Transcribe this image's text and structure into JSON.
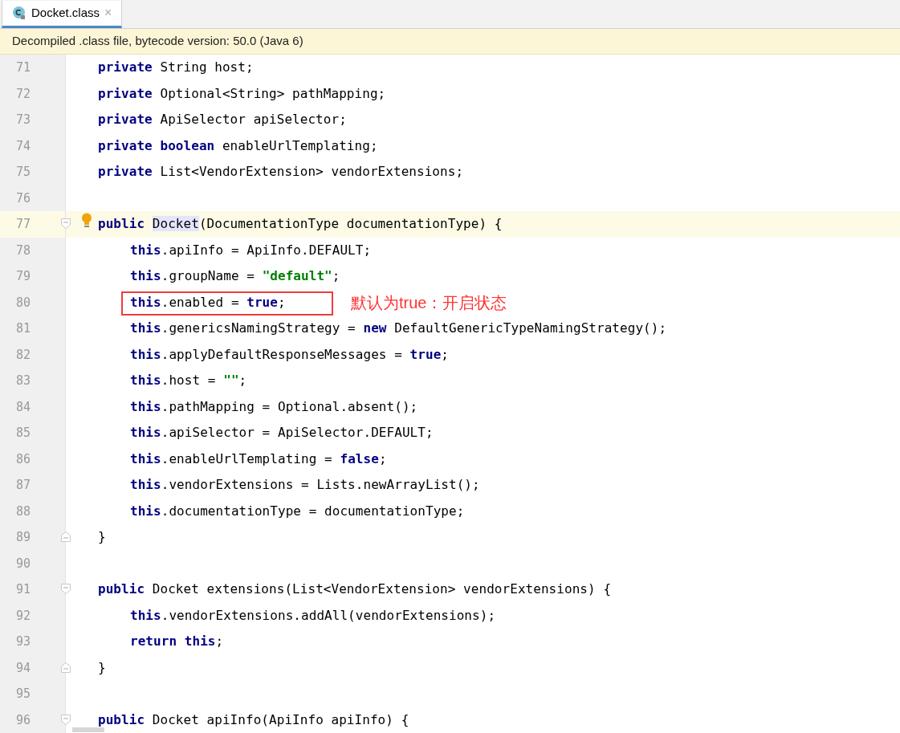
{
  "tab": {
    "title": "Docket.class",
    "selected": true,
    "close": "×"
  },
  "banner": "Decompiled .class file, bytecode version: 50.0 (Java 6)",
  "lines": [
    {
      "number": "71",
      "kind": "member",
      "segments": [
        {
          "kind": "kw",
          "t": "private"
        },
        {
          "kind": "plain",
          "t": " String host;"
        }
      ]
    },
    {
      "number": "72",
      "kind": "member",
      "segments": [
        {
          "kind": "kw",
          "t": "private"
        },
        {
          "kind": "plain",
          "t": " Optional<String> pathMapping;"
        }
      ]
    },
    {
      "number": "73",
      "kind": "member",
      "segments": [
        {
          "kind": "kw",
          "t": "private"
        },
        {
          "kind": "plain",
          "t": " ApiSelector apiSelector;"
        }
      ]
    },
    {
      "number": "74",
      "kind": "member",
      "segments": [
        {
          "kind": "kw",
          "t": "private boolean"
        },
        {
          "kind": "plain",
          "t": " enableUrlTemplating;"
        }
      ]
    },
    {
      "number": "75",
      "kind": "member",
      "segments": [
        {
          "kind": "kw",
          "t": "private"
        },
        {
          "kind": "plain",
          "t": " List<VendorExtension> vendorExtensions;"
        }
      ]
    },
    {
      "number": "76"
    },
    {
      "number": "77",
      "kind": "member",
      "current": true,
      "bulb": true,
      "fold": {
        "kind": "start"
      },
      "segments": [
        {
          "kind": "kw",
          "t": "public "
        },
        {
          "kind": "ref",
          "t": "Docket"
        },
        {
          "kind": "plain",
          "t": "(DocumentationType documentationType) {"
        }
      ]
    },
    {
      "number": "78",
      "kind": "statement",
      "segments": [
        {
          "kind": "kw",
          "t": "this"
        },
        {
          "kind": "plain",
          "t": ".apiInfo = ApiInfo.DEFAULT;"
        }
      ]
    },
    {
      "number": "79",
      "kind": "statement",
      "segments": [
        {
          "kind": "kw",
          "t": "this"
        },
        {
          "kind": "plain",
          "t": ".groupName = "
        },
        {
          "kind": "str",
          "t": "\"default\""
        },
        {
          "kind": "plain",
          "t": ";"
        }
      ]
    },
    {
      "number": "80",
      "kind": "statement",
      "note": "默认为true：开启状态",
      "segments": [
        {
          "kind": "kw",
          "t": "this"
        },
        {
          "kind": "plain",
          "t": ".enabled = "
        },
        {
          "kind": "kw",
          "t": "true"
        },
        {
          "kind": "plain",
          "t": ";"
        }
      ]
    },
    {
      "number": "81",
      "kind": "statement",
      "segments": [
        {
          "kind": "kw",
          "t": "this"
        },
        {
          "kind": "plain",
          "t": ".genericsNamingStrategy = "
        },
        {
          "kind": "kw",
          "t": "new"
        },
        {
          "kind": "plain",
          "t": " DefaultGenericTypeNamingStrategy();"
        }
      ]
    },
    {
      "number": "82",
      "kind": "statement",
      "segments": [
        {
          "kind": "kw",
          "t": "this"
        },
        {
          "kind": "plain",
          "t": ".applyDefaultResponseMessages = "
        },
        {
          "kind": "kw",
          "t": "true"
        },
        {
          "kind": "plain",
          "t": ";"
        }
      ]
    },
    {
      "number": "83",
      "kind": "statement",
      "segments": [
        {
          "kind": "kw",
          "t": "this"
        },
        {
          "kind": "plain",
          "t": ".host = "
        },
        {
          "kind": "str",
          "t": "\"\""
        },
        {
          "kind": "plain",
          "t": ";"
        }
      ]
    },
    {
      "number": "84",
      "kind": "statement",
      "segments": [
        {
          "kind": "kw",
          "t": "this"
        },
        {
          "kind": "plain",
          "t": ".pathMapping = Optional.absent();"
        }
      ]
    },
    {
      "number": "85",
      "kind": "statement",
      "segments": [
        {
          "kind": "kw",
          "t": "this"
        },
        {
          "kind": "plain",
          "t": ".apiSelector = ApiSelector.DEFAULT;"
        }
      ]
    },
    {
      "number": "86",
      "kind": "statement",
      "segments": [
        {
          "kind": "kw",
          "t": "this"
        },
        {
          "kind": "plain",
          "t": ".enableUrlTemplating = "
        },
        {
          "kind": "kw",
          "t": "false"
        },
        {
          "kind": "plain",
          "t": ";"
        }
      ]
    },
    {
      "number": "87",
      "kind": "statement",
      "segments": [
        {
          "kind": "kw",
          "t": "this"
        },
        {
          "kind": "plain",
          "t": ".vendorExtensions = Lists.newArrayList();"
        }
      ]
    },
    {
      "number": "88",
      "kind": "statement",
      "segments": [
        {
          "kind": "kw",
          "t": "this"
        },
        {
          "kind": "plain",
          "t": ".documentationType = documentationType;"
        }
      ]
    },
    {
      "number": "89",
      "kind": "member",
      "fold": {
        "kind": "end"
      },
      "segments": [
        {
          "kind": "plain",
          "t": "}"
        }
      ]
    },
    {
      "number": "90"
    },
    {
      "number": "91",
      "kind": "member",
      "fold": {
        "kind": "start"
      },
      "segments": [
        {
          "kind": "kw",
          "t": "public"
        },
        {
          "kind": "plain",
          "t": " Docket extensions(List<VendorExtension> vendorExtensions) {"
        }
      ]
    },
    {
      "number": "92",
      "kind": "statement",
      "segments": [
        {
          "kind": "kw",
          "t": "this"
        },
        {
          "kind": "plain",
          "t": ".vendorExtensions.addAll(vendorExtensions);"
        }
      ]
    },
    {
      "number": "93",
      "kind": "statement",
      "segments": [
        {
          "kind": "kw",
          "t": "return this"
        },
        {
          "kind": "plain",
          "t": ";"
        }
      ]
    },
    {
      "number": "94",
      "kind": "member",
      "fold": {
        "kind": "end"
      },
      "segments": [
        {
          "kind": "plain",
          "t": "}"
        }
      ]
    },
    {
      "number": "95"
    },
    {
      "number": "96",
      "kind": "member",
      "fold": {
        "kind": "start"
      },
      "segments": [
        {
          "kind": "kw",
          "t": "public"
        },
        {
          "kind": "plain",
          "t": " Docket apiInfo(ApiInfo apiInfo) {"
        }
      ]
    }
  ]
}
